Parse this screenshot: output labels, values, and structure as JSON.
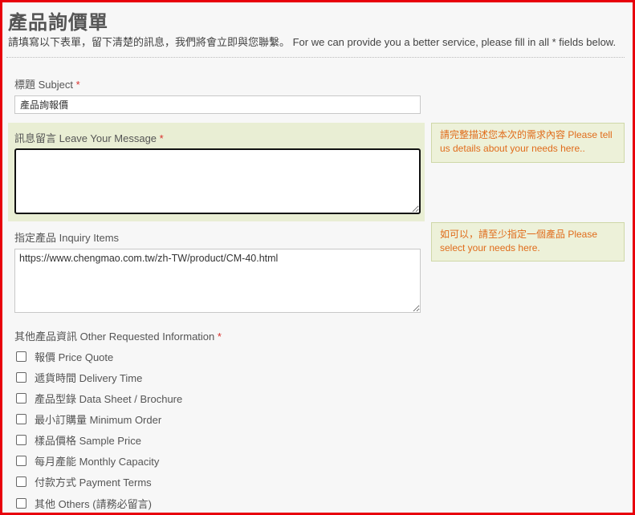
{
  "header": {
    "title": "產品詢價單",
    "subtitle": "請填寫以下表單，留下清楚的訊息，我們將會立即與您聯繫。 For we can provide you a better service, please fill in all * fields below."
  },
  "fields": {
    "subject": {
      "label": "標題 Subject",
      "required_mark": "*",
      "value": "產品詢報價"
    },
    "message": {
      "label": "訊息留言 Leave Your Message",
      "required_mark": "*",
      "value": "",
      "hint": "請完整描述您本次的需求內容 Please tell us details about your needs here.."
    },
    "inquiry_items": {
      "label": "指定產品 Inquiry Items",
      "value": "https://www.chengmao.com.tw/zh-TW/product/CM-40.html",
      "hint": "如可以，請至少指定一個產品 Please select your needs here."
    },
    "other_info": {
      "label": "其他產品資訊 Other Requested Information",
      "required_mark": "*",
      "options": [
        {
          "label": "報價 Price Quote",
          "checked": false
        },
        {
          "label": "遞貨時間 Delivery Time",
          "checked": false
        },
        {
          "label": "產品型錄 Data Sheet / Brochure",
          "checked": false
        },
        {
          "label": "最小訂購量 Minimum Order",
          "checked": false
        },
        {
          "label": "樣品價格 Sample Price",
          "checked": false
        },
        {
          "label": "每月產能 Monthly Capacity",
          "checked": false
        },
        {
          "label": "付款方式 Payment Terms",
          "checked": false
        },
        {
          "label": "其他 Others (請務必留言)",
          "checked": false
        }
      ]
    }
  },
  "colors": {
    "required": "#d9302c",
    "hint_text": "#e06c1b",
    "hint_bg": "#edf1d9",
    "panel_bg": "#e9eed4",
    "frame": "#e8000b"
  }
}
